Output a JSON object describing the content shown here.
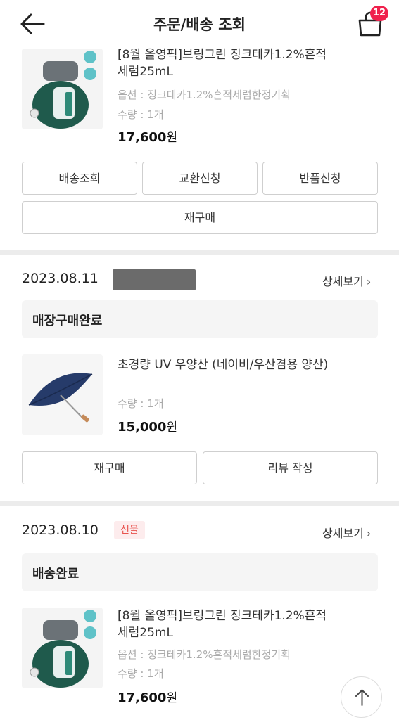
{
  "header": {
    "title": "주문/배송 조회",
    "cart_count": "12"
  },
  "orders": [
    {
      "product": {
        "name": "[8월 올영픽]브링그린 징크테카1.2%흔적세럼25mL",
        "option": "옵션 : 징크테카1.2%흔적세럼한정기획",
        "qty": "수량 : 1개",
        "price": "17,600",
        "currency": "원"
      },
      "buttons": {
        "track": "배송조회",
        "exchange": "교환신청",
        "return": "반품신청",
        "reorder": "재구매"
      }
    },
    {
      "date": "2023.08.11",
      "detail": "상세보기",
      "status": "매장구매완료",
      "product": {
        "name": "초경량 UV 우양산 (네이비/우산겸용 양산)",
        "qty": "수량 : 1개",
        "price": "15,000",
        "currency": "원"
      },
      "buttons": {
        "reorder": "재구매",
        "review": "리뷰 작성"
      }
    },
    {
      "date": "2023.08.10",
      "tag": "선물",
      "detail": "상세보기",
      "status": "배송완료",
      "product": {
        "name": "[8월 올영픽]브링그린 징크테카1.2%흔적세럼25mL",
        "option": "옵션 : 징크테카1.2%흔적세럼한정기획",
        "qty": "수량 : 1개",
        "price": "17,600",
        "currency": "원"
      }
    }
  ],
  "colors": {
    "accent": "#f0204c",
    "gift": "#e8534e",
    "divider": "#ececec",
    "status_bg": "#f5f5f5"
  }
}
